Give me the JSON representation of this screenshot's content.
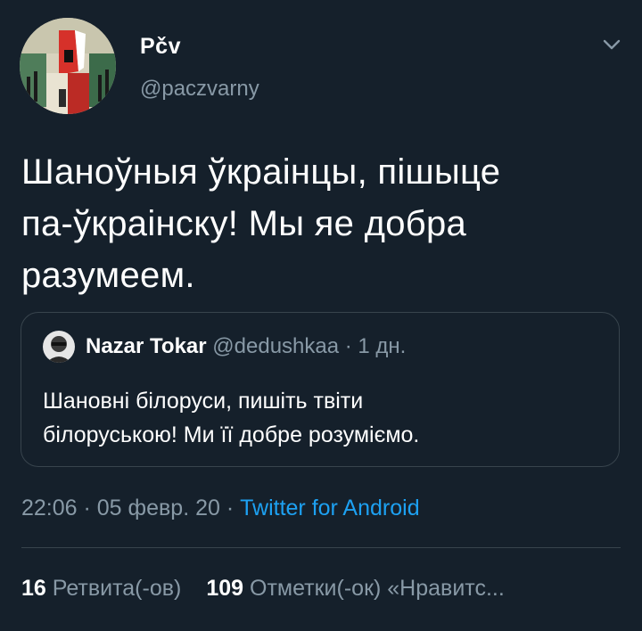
{
  "tweet": {
    "author": {
      "name": "Pčv",
      "handle": "@paczvarny"
    },
    "text_lines": [
      "Шаноўныя ўкраінцы, пішыце",
      "па-ўкраінску! Мы яе добра",
      "разумеем."
    ],
    "quoted": {
      "name": "Nazar Tokar",
      "handle": "@dedushkaa",
      "separator": " · ",
      "time": "1 дн.",
      "text_lines": [
        "Шановні білоруси, пишіть твіти",
        "білоруською! Ми її добре розуміємо."
      ]
    },
    "meta": {
      "time": "22:06",
      "separator1": " · ",
      "date": "05 февр. 20",
      "separator2": " · ",
      "source": "Twitter for Android"
    },
    "stats": {
      "retweets_count": "16",
      "retweets_label": " Ретвита(-ов)",
      "likes_count": "109",
      "likes_label": " Отметки(-ок) «Нравитс..."
    }
  },
  "icons": {
    "chevron": "chevron-down-icon"
  },
  "colors": {
    "background": "#15202b",
    "text": "#ffffff",
    "secondary": "#8899a6",
    "link": "#1da1f2",
    "border": "#38444d"
  }
}
